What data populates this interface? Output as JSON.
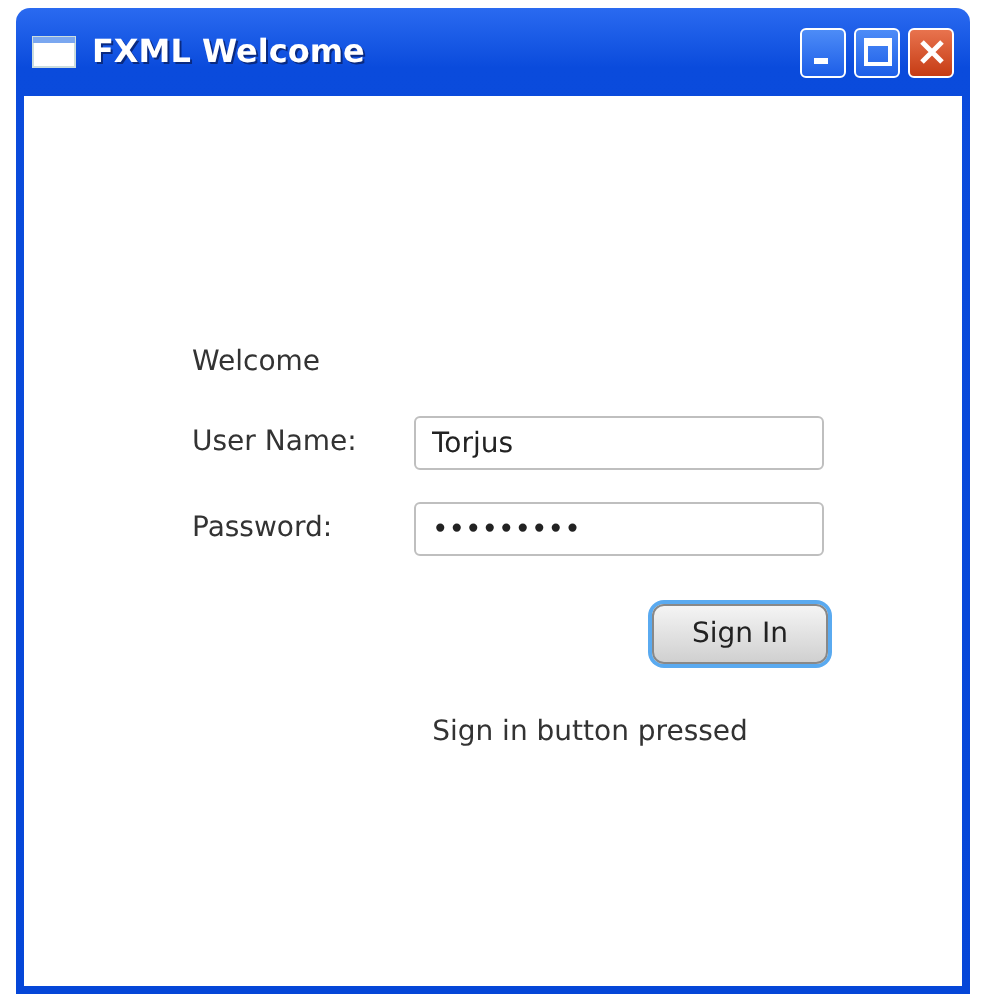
{
  "window": {
    "title": "FXML Welcome"
  },
  "heading": "Welcome",
  "fields": [
    {
      "label": "User Name:",
      "value": "Torjus"
    },
    {
      "label": "Password:",
      "value": "•••••••••"
    }
  ],
  "button": {
    "label": "Sign In",
    "focused": true
  },
  "status": "Sign in button pressed"
}
